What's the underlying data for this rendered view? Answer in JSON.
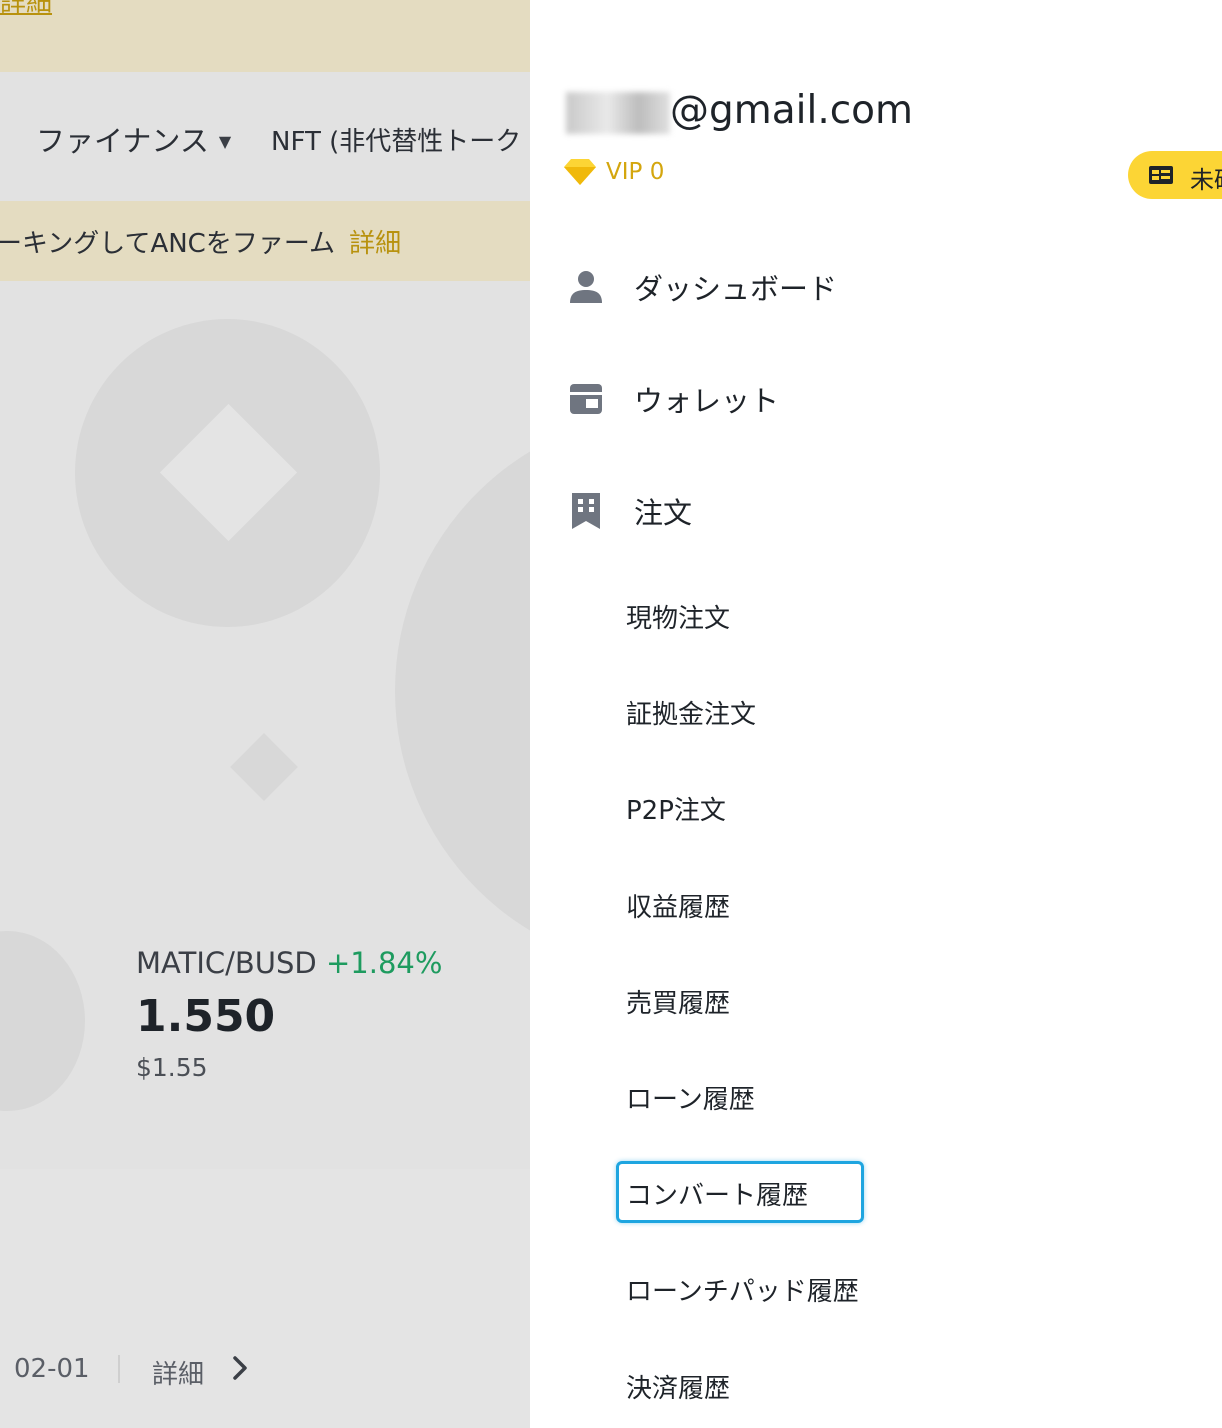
{
  "left_page": {
    "top_banner_link": "詳細",
    "nav": {
      "finance": "ファイナンス",
      "nft": "NFT (非代替性トーク"
    },
    "promo": {
      "text": "ーキングしてANCをファーム",
      "link": "詳細"
    },
    "ticker": {
      "pair": "MATIC/BUSD",
      "change": "+1.84%",
      "price": "1.550",
      "usd": "$1.55"
    },
    "news": {
      "date": "02-01",
      "detail": "詳細"
    }
  },
  "drawer": {
    "email_visible": "@gmail.com",
    "vip": "VIP 0",
    "verify": "未確",
    "menu": {
      "dashboard": "ダッシュボード",
      "wallet": "ウォレット",
      "orders": "注文"
    },
    "sub_items": [
      "現物注文",
      "証拠金注文",
      "P2P注文",
      "収益履歴",
      "売買履歴",
      "ローン履歴",
      "コンバート履歴",
      "ローンチパッド履歴",
      "決済履歴"
    ],
    "highlighted_item": "コンバート履歴"
  },
  "colors": {
    "accent_gold": "#d4a60e",
    "brand_yellow": "#fcd535",
    "positive_green": "#1e9b5f",
    "highlight_blue": "#1ea5e0"
  }
}
